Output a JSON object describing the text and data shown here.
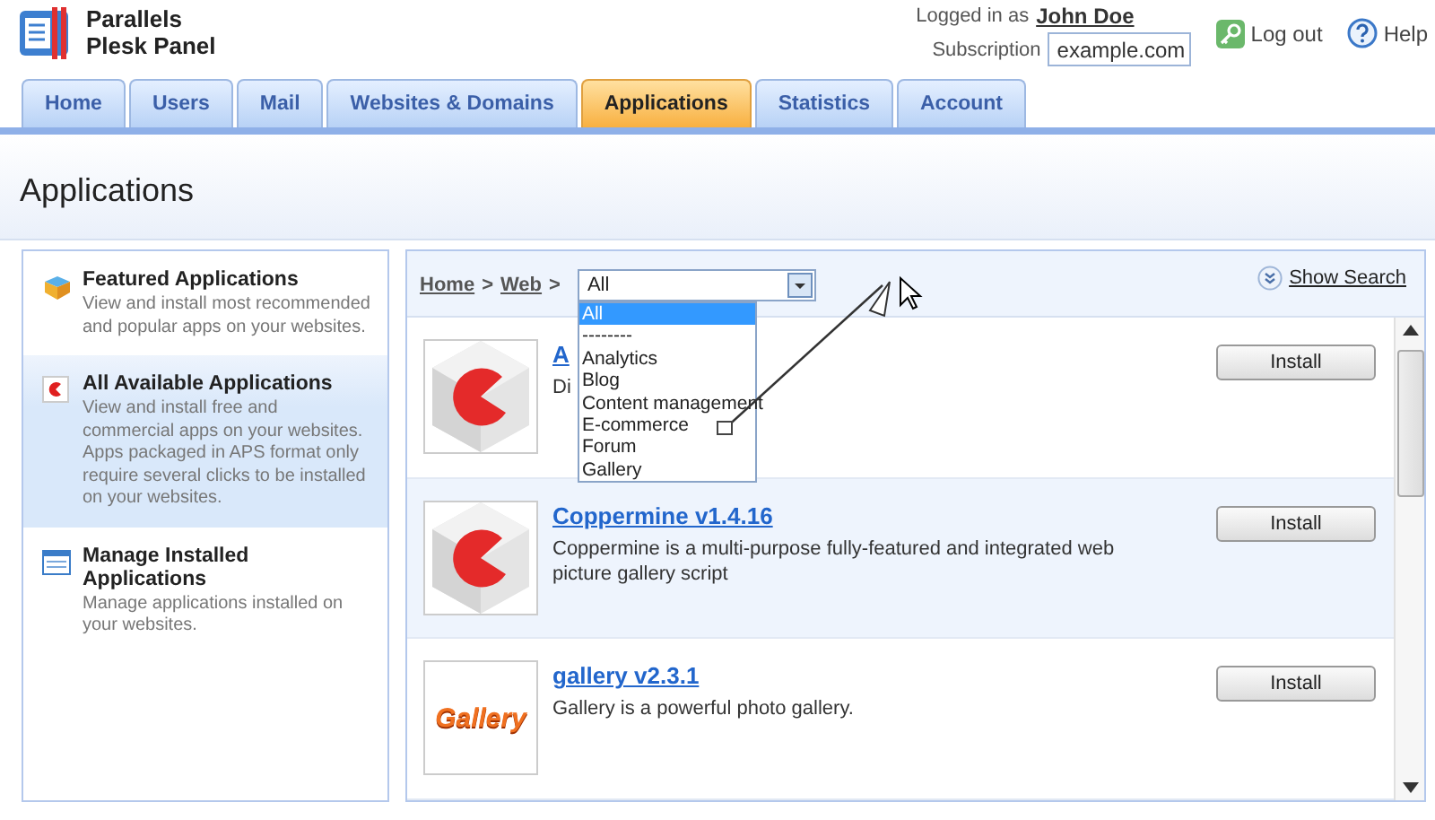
{
  "brand": {
    "line1": "Parallels",
    "line2": "Plesk Panel"
  },
  "user": {
    "label": "Logged in as",
    "name": "John Doe",
    "subscription_label": "Subscription",
    "subscription": "example.com"
  },
  "header_links": [
    {
      "kind": "logout",
      "label": "Log out"
    },
    {
      "kind": "help",
      "label": "Help"
    }
  ],
  "tabs": [
    {
      "label": "Home",
      "selected": false
    },
    {
      "label": "Users",
      "selected": false
    },
    {
      "label": "Mail",
      "selected": false
    },
    {
      "label": "Websites & Domains",
      "selected": false
    },
    {
      "label": "Applications",
      "selected": true
    },
    {
      "label": "Statistics",
      "selected": false
    },
    {
      "label": "Account",
      "selected": false
    }
  ],
  "page_title": "Applications",
  "sidebar": {
    "items": [
      {
        "kind": "featured",
        "title": "Featured Applications",
        "description": "View and install most recommended and popular apps on your websites.",
        "selected": false
      },
      {
        "kind": "all",
        "title": "All Available Applications",
        "description": "View and install free and commercial apps on your websites. Apps packaged in APS format only require several clicks to be installed on your websites.",
        "selected": true
      },
      {
        "kind": "manage",
        "title": "Manage Installed Applications",
        "description": "Manage applications installed on your websites.",
        "selected": false
      }
    ]
  },
  "breadcrumb": [
    {
      "label": "Home",
      "separator": ">"
    },
    {
      "label": "Web",
      "separator": ">"
    }
  ],
  "category_select": {
    "value": "All",
    "expanded": true,
    "options": [
      {
        "label": "All",
        "selected": true
      },
      {
        "label": "--------",
        "selected": false
      },
      {
        "label": "Analytics",
        "selected": false
      },
      {
        "label": "Blog",
        "selected": false
      },
      {
        "label": "Content management",
        "selected": false
      },
      {
        "label": "E-commerce",
        "selected": false
      },
      {
        "label": "Forum",
        "selected": false
      },
      {
        "label": "Gallery",
        "selected": false
      }
    ]
  },
  "show_search": "Show Search",
  "apps": [
    {
      "kind": "cube",
      "title": "A",
      "description": "Di",
      "button": "Install",
      "highlighted": false
    },
    {
      "kind": "cube",
      "title": "Coppermine v1.4.16",
      "description": "Coppermine is a multi-purpose fully-featured and integrated web picture gallery script",
      "button": "Install",
      "highlighted": true
    },
    {
      "kind": "gallery",
      "logo_text": "Gallery",
      "title": "gallery v2.3.1",
      "description": "Gallery is a powerful photo gallery.",
      "button": "Install",
      "highlighted": false
    }
  ]
}
